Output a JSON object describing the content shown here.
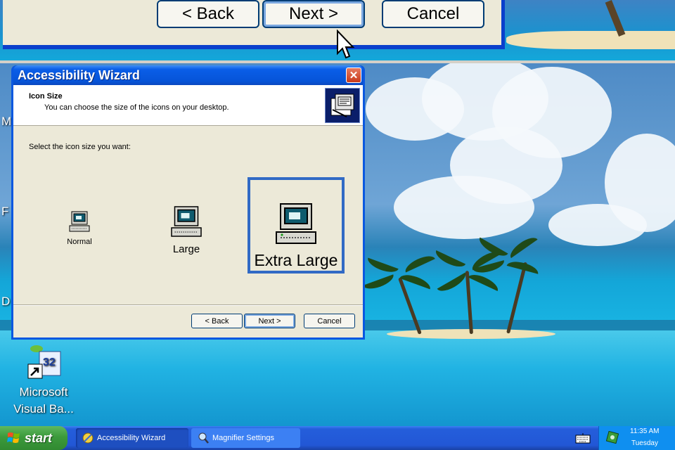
{
  "magnifier": {
    "back_label": "< Back",
    "next_label": "Next >",
    "cancel_label": "Cancel"
  },
  "wizard": {
    "title": "Accessibility Wizard",
    "close_icon": "close-icon",
    "header_title": "Icon Size",
    "header_subtitle": "You can choose the size of the icons on your desktop.",
    "prompt": "Select the icon size you want:",
    "options": [
      {
        "label": "Normal",
        "icon": "computer-icon",
        "selected": false
      },
      {
        "label": "Large",
        "icon": "computer-icon",
        "selected": false
      },
      {
        "label": "Extra Large",
        "icon": "computer-icon",
        "selected": true
      }
    ],
    "back_label": "< Back",
    "next_label": "Next >",
    "cancel_label": "Cancel"
  },
  "desktop": {
    "icons": [
      {
        "label_line1": "Microsoft",
        "label_line2": "Visual Ba...",
        "icon": "visual-basic-shortcut-icon"
      }
    ],
    "edge_letters": [
      "M",
      "F",
      "D"
    ]
  },
  "taskbar": {
    "start_label": "start",
    "tasks": [
      {
        "label": "Accessibility Wizard",
        "active": true
      },
      {
        "label": "Magnifier Settings",
        "active": false
      }
    ],
    "clock_time": "11:35 AM",
    "clock_day": "Tuesday"
  },
  "colors": {
    "xp_blue": "#0a58e0",
    "dialog_gray": "#ece9d8",
    "selection_blue": "#316ac5",
    "start_green": "#3c9a3c"
  }
}
